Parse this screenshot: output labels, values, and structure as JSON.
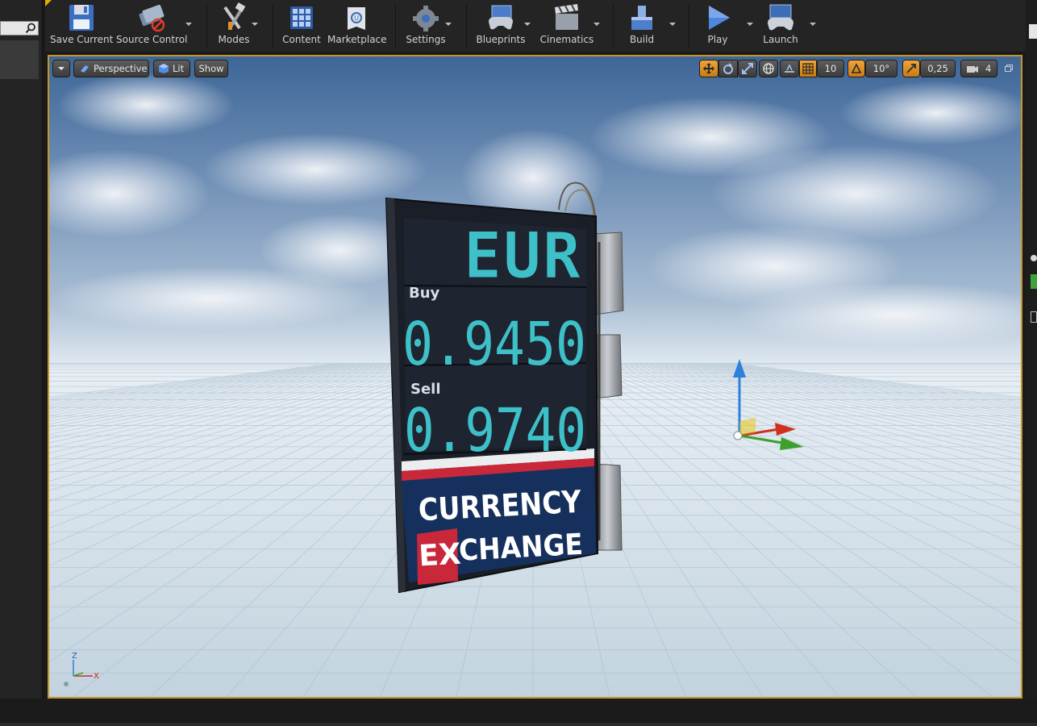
{
  "toolbar": {
    "save_current": "Save Current",
    "source_control": "Source Control",
    "modes": "Modes",
    "content": "Content",
    "marketplace": "Marketplace",
    "settings": "Settings",
    "blueprints": "Blueprints",
    "cinematics": "Cinematics",
    "build": "Build",
    "play": "Play",
    "launch": "Launch"
  },
  "viewport": {
    "perspective_label": "Perspective",
    "lit_label": "Lit",
    "show_label": "Show",
    "grid_snap_value": "10",
    "rotation_snap_value": "10°",
    "scale_snap_value": "0,25",
    "camera_speed_value": "4"
  },
  "sign": {
    "currency": "EUR",
    "buy_label": "Buy",
    "buy_value": "0.9450",
    "sell_label": "Sell",
    "sell_value": "0.9740",
    "brand_line1": "CURRENCY",
    "brand_line2_highlight": "EX",
    "brand_line2_rest": "CHANGE"
  },
  "axis": {
    "z": "Z",
    "x": "X"
  },
  "colors": {
    "accent": "#e6a80a",
    "selection_border": "#c7962a",
    "led": "#3ec0c8",
    "sign_blue": "#16305e",
    "sign_red": "#c8283a"
  }
}
